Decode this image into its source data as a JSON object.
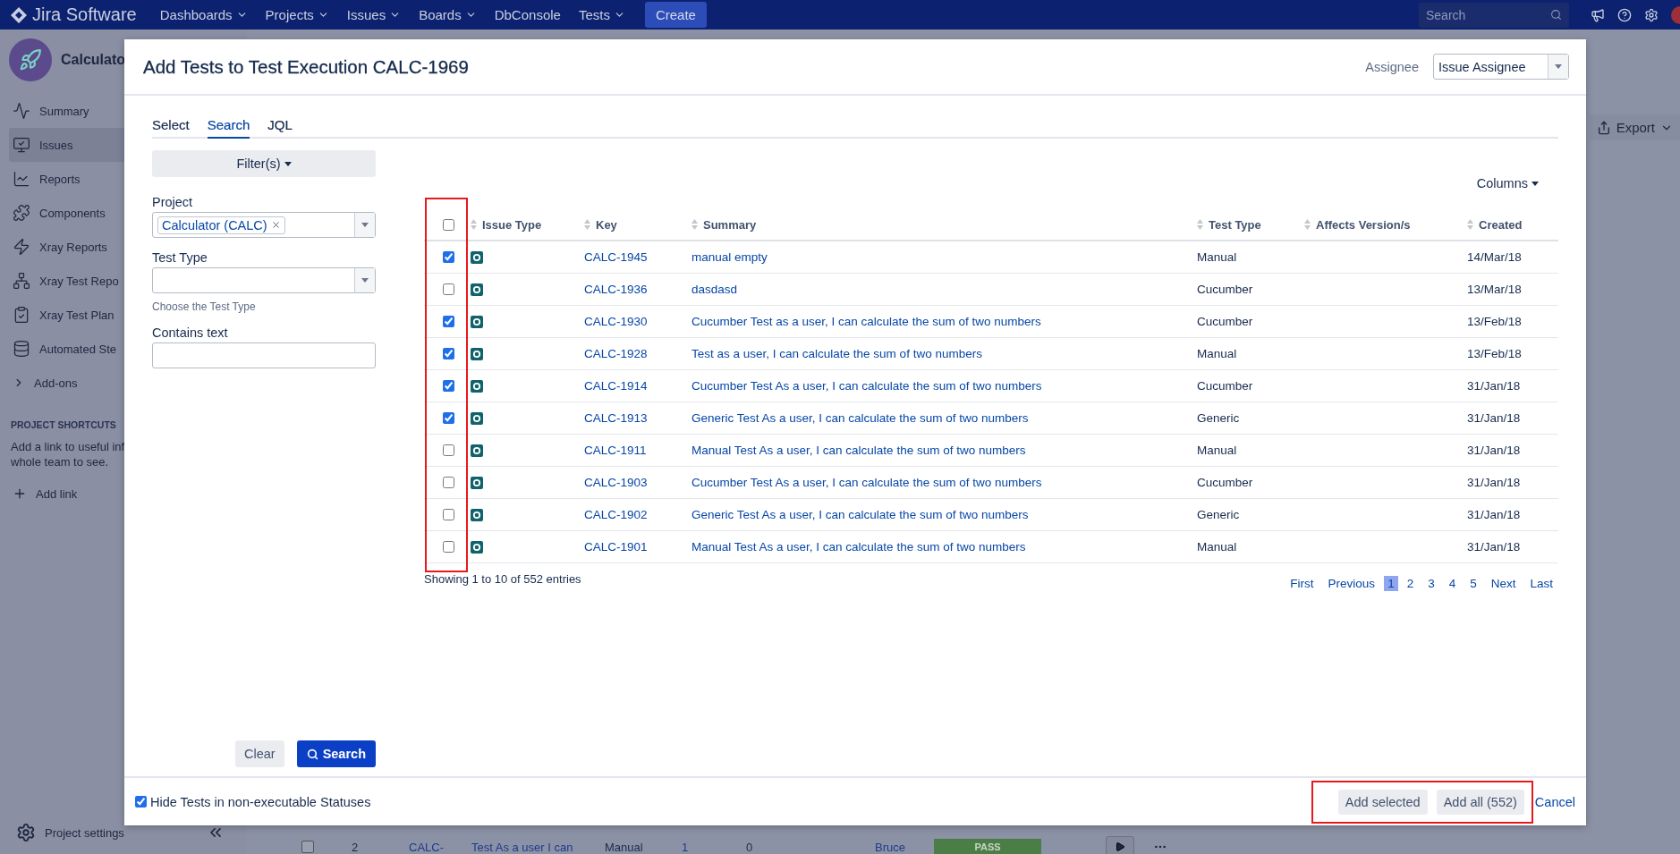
{
  "nav": {
    "logo": "Jira Software",
    "menus": [
      {
        "label": "Dashboards",
        "dropdown": true
      },
      {
        "label": "Projects",
        "dropdown": true
      },
      {
        "label": "Issues",
        "dropdown": true
      },
      {
        "label": "Boards",
        "dropdown": true
      },
      {
        "label": "DbConsole",
        "dropdown": false
      },
      {
        "label": "Tests",
        "dropdown": true
      }
    ],
    "create": "Create",
    "search_placeholder": "Search"
  },
  "sidebar": {
    "project": "Calculato",
    "items": [
      {
        "label": "Summary",
        "selected": false
      },
      {
        "label": "Issues",
        "selected": true
      },
      {
        "label": "Reports",
        "selected": false
      },
      {
        "label": "Components",
        "selected": false
      },
      {
        "label": "Xray Reports",
        "selected": false
      },
      {
        "label": "Xray Test Repo",
        "selected": false
      },
      {
        "label": "Xray Test Plan",
        "selected": false
      },
      {
        "label": "Automated Ste",
        "selected": false
      }
    ],
    "addons": "Add-ons",
    "shortcuts_heading": "PROJECT SHORTCUTS",
    "shortcuts_lines": [
      "Add a link to useful inf",
      "whole team to see."
    ],
    "add_link": "Add link",
    "settings": "Project settings"
  },
  "page": {
    "export": "Export",
    "background_row": {
      "checked": false,
      "number": "2",
      "key": "CALC-",
      "summary": "Test As a user I can",
      "type": "Manual",
      "count_1": "1",
      "count_2": "0",
      "assignee": "Bruce",
      "status": "PASS"
    }
  },
  "dialog": {
    "title": "Add Tests to Test Execution CALC-1969",
    "assignee_label": "Assignee",
    "assignee_value": "Issue Assignee",
    "tabs": [
      {
        "label": "Select",
        "selected": false
      },
      {
        "label": "Search",
        "selected": true
      },
      {
        "label": "JQL",
        "selected": false
      }
    ],
    "filters_button": "Filter(s)",
    "fields": [
      {
        "kind": "tags",
        "label": "Project",
        "tags": [
          "Calculator (CALC)"
        ]
      },
      {
        "kind": "select",
        "label": "Test Type",
        "hint": "Choose the Test Type"
      },
      {
        "kind": "text",
        "label": "Contains text"
      }
    ],
    "clear": "Clear",
    "search": "Search",
    "columns_button": "Columns",
    "table": {
      "select_all": false,
      "columns": [
        "Issue Type",
        "Key",
        "Summary",
        "Test Type",
        "Affects Version/s",
        "Created"
      ],
      "rows": [
        {
          "selected": true,
          "key": "CALC-1945",
          "summary": "manual empty",
          "test_type": "Manual",
          "created": "14/Mar/18"
        },
        {
          "selected": false,
          "key": "CALC-1936",
          "summary": "dasdasd",
          "test_type": "Cucumber",
          "created": "13/Mar/18"
        },
        {
          "selected": true,
          "key": "CALC-1930",
          "summary": "Cucumber Test as a user, I can calculate the sum of two numbers",
          "test_type": "Cucumber",
          "created": "13/Feb/18"
        },
        {
          "selected": true,
          "key": "CALC-1928",
          "summary": "Test as a user, I can calculate the sum of two numbers",
          "test_type": "Manual",
          "created": "13/Feb/18"
        },
        {
          "selected": true,
          "key": "CALC-1914",
          "summary": "Cucumber Test As a user, I can calculate the sum of two numbers",
          "test_type": "Cucumber",
          "created": "31/Jan/18"
        },
        {
          "selected": true,
          "key": "CALC-1913",
          "summary": "Generic Test As a user, I can calculate the sum of two numbers",
          "test_type": "Generic",
          "created": "31/Jan/18"
        },
        {
          "selected": false,
          "key": "CALC-1911",
          "summary": "Manual Test As a user, I can calculate the sum of two numbers",
          "test_type": "Manual",
          "created": "31/Jan/18"
        },
        {
          "selected": false,
          "key": "CALC-1903",
          "summary": "Cucumber Test As a user, I can calculate the sum of two numbers",
          "test_type": "Cucumber",
          "created": "31/Jan/18"
        },
        {
          "selected": false,
          "key": "CALC-1902",
          "summary": "Generic Test As a user, I can calculate the sum of two numbers",
          "test_type": "Generic",
          "created": "31/Jan/18"
        },
        {
          "selected": false,
          "key": "CALC-1901",
          "summary": "Manual Test As a user, I can calculate the sum of two numbers",
          "test_type": "Manual",
          "created": "31/Jan/18"
        }
      ]
    },
    "info": "Showing 1 to 10 of 552 entries",
    "pages": [
      {
        "label": "First",
        "selected": false
      },
      {
        "label": "Previous",
        "selected": false
      },
      {
        "label": "1",
        "selected": true
      },
      {
        "label": "2",
        "selected": false
      },
      {
        "label": "3",
        "selected": false
      },
      {
        "label": "4",
        "selected": false
      },
      {
        "label": "5",
        "selected": false
      },
      {
        "label": "Next",
        "selected": false
      },
      {
        "label": "Last",
        "selected": false
      }
    ],
    "footer": {
      "hide_tests": {
        "label": "Hide Tests in non-executable Statuses",
        "checked": true
      },
      "add_selected": "Add selected",
      "add_all": "Add all (552)",
      "cancel": "Cancel"
    }
  }
}
